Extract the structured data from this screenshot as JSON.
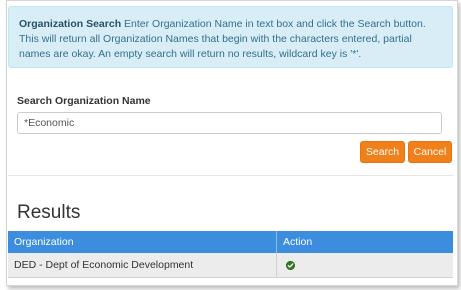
{
  "info": {
    "title": "Organization Search",
    "text": " Enter Organization Name in text box and click the Search button. This will return all Organization Names that begin with the characters entered, partial names are okay. An empty search will return no results, wildcard key is '*'."
  },
  "search": {
    "label": "Search Organization Name",
    "value": "*Economic",
    "search_button": "Search",
    "cancel_button": "Cancel"
  },
  "results": {
    "heading": "Results",
    "columns": [
      "Organization",
      "Action"
    ],
    "rows": [
      {
        "organization": "DED - Dept of Economic Development",
        "action_icon": "check-circle-icon"
      }
    ]
  },
  "colors": {
    "accent_orange": "#f0801a",
    "header_blue": "#3c8dde",
    "info_bg": "#d9edf7"
  }
}
